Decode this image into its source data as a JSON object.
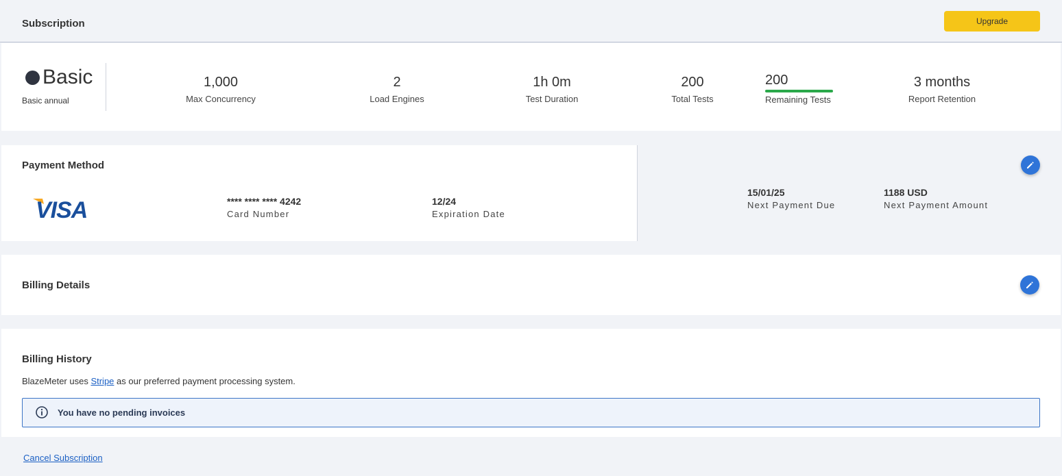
{
  "header": {
    "title": "Subscription",
    "upgrade_label": "Upgrade"
  },
  "plan": {
    "name": "Basic",
    "subtitle": "Basic annual",
    "stats": {
      "max_concurrency": {
        "value": "1,000",
        "label": "Max Concurrency"
      },
      "load_engines": {
        "value": "2",
        "label": "Load Engines"
      },
      "test_duration": {
        "value": "1h 0m",
        "label": "Test Duration"
      },
      "total_tests": {
        "value": "200",
        "label": "Total Tests"
      },
      "remaining_tests": {
        "value": "200",
        "label": "Remaining Tests",
        "fraction": 1.0
      },
      "report_retention": {
        "value": "3 months",
        "label": "Report Retention"
      }
    }
  },
  "payment": {
    "title": "Payment Method",
    "brand_icon": "visa-logo",
    "card_number": {
      "value": "**** **** **** 4242",
      "label": "Card Number"
    },
    "expiration": {
      "value": "12/24",
      "label": "Expiration Date"
    },
    "next_due": {
      "value": "15/01/25",
      "label": "Next Payment Due"
    },
    "next_amount": {
      "value": "1188 USD",
      "label": "Next Payment Amount"
    }
  },
  "billing_details": {
    "title": "Billing Details"
  },
  "billing_history": {
    "title": "Billing History",
    "text_prefix": "BlazeMeter uses ",
    "link_text": "Stripe",
    "text_suffix": " as our preferred payment processing system.",
    "notice": "You have no pending invoices"
  },
  "footer": {
    "cancel_label": "Cancel Subscription"
  },
  "colors": {
    "accent": "#2f74d8",
    "upgrade": "#f5c518",
    "progress": "#2aa84a",
    "background": "#f1f3f7"
  }
}
